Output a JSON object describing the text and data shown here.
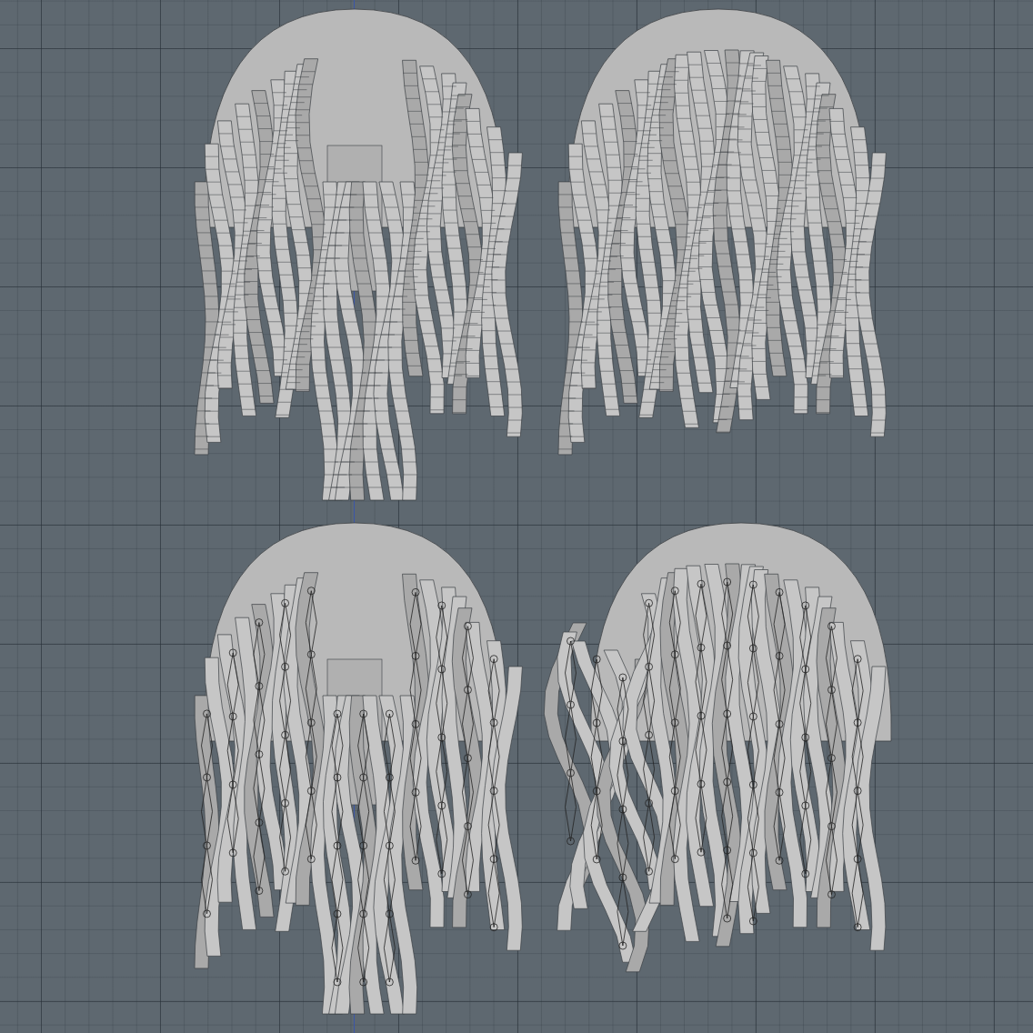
{
  "views": [
    {
      "kind": "wireframe-front"
    },
    {
      "kind": "wireframe-back"
    },
    {
      "kind": "rigged-front"
    },
    {
      "kind": "rigged-side"
    }
  ]
}
